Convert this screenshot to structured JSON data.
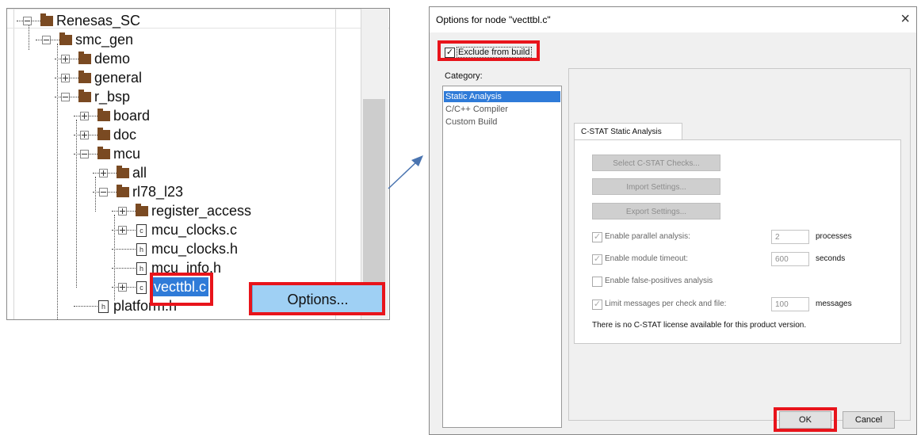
{
  "tree": {
    "nodes": [
      {
        "label": "Renesas_SC",
        "icon": "folder-icon",
        "expander": "minus"
      },
      {
        "label": "smc_gen",
        "icon": "folder-icon",
        "expander": "minus"
      },
      {
        "label": "demo",
        "icon": "folder-icon",
        "expander": "plus"
      },
      {
        "label": "general",
        "icon": "folder-icon",
        "expander": "plus"
      },
      {
        "label": "r_bsp",
        "icon": "folder-icon",
        "expander": "minus"
      },
      {
        "label": "board",
        "icon": "folder-icon",
        "expander": "plus"
      },
      {
        "label": "doc",
        "icon": "folder-icon",
        "expander": "plus"
      },
      {
        "label": "mcu",
        "icon": "folder-icon",
        "expander": "minus"
      },
      {
        "label": "all",
        "icon": "folder-icon",
        "expander": "plus"
      },
      {
        "label": "rl78_l23",
        "icon": "folder-icon",
        "expander": "minus"
      },
      {
        "label": "register_access",
        "icon": "folder-icon",
        "expander": "plus"
      },
      {
        "label": "mcu_clocks.c",
        "icon": "c-file-icon",
        "icon_glyph": "c",
        "expander": "plus"
      },
      {
        "label": "mcu_clocks.h",
        "icon": "h-file-icon",
        "icon_glyph": "h",
        "expander": "none"
      },
      {
        "label": "mcu_info.h",
        "icon": "h-file-icon",
        "icon_glyph": "h",
        "expander": "none"
      },
      {
        "label": "vecttbl.c",
        "icon": "c-file-icon",
        "icon_glyph": "c",
        "expander": "plus",
        "selected": true
      },
      {
        "label": "platform.h",
        "icon": "h-file-icon",
        "icon_glyph": "h",
        "expander": "none"
      }
    ],
    "context_menu_item": "Options..."
  },
  "dialog": {
    "title": "Options for node \"vecttbl.c\"",
    "close_glyph": "×",
    "exclude_from_build": {
      "label": "Exclude from build",
      "checked": true
    },
    "category_label": "Category:",
    "categories": [
      {
        "label": "Static Analysis",
        "selected": true
      },
      {
        "label": "C/C++ Compiler",
        "selected": false
      },
      {
        "label": "Custom Build",
        "selected": false
      }
    ],
    "tab_label": "C-STAT Static Analysis",
    "buttons": {
      "select_checks": "Select C-STAT Checks...",
      "import": "Import Settings...",
      "export": "Export Settings..."
    },
    "options": {
      "parallel": {
        "label": "Enable parallel analysis:",
        "checked": true,
        "value": "2",
        "unit": "processes"
      },
      "timeout": {
        "label": "Enable module timeout:",
        "checked": true,
        "value": "600",
        "unit": "seconds"
      },
      "false_positives": {
        "label": "Enable false-positives analysis",
        "checked": false
      },
      "limit": {
        "label": "Limit messages per check and file:",
        "checked": true,
        "value": "100",
        "unit": "messages"
      }
    },
    "license_note": "There is no C-STAT license available for this product version.",
    "ok_label": "OK",
    "cancel_label": "Cancel"
  },
  "colors": {
    "highlight": "#e8141b",
    "selection": "#2f7bd8",
    "context_menu": "#9fd0f4",
    "folder": "#7a4a22"
  }
}
